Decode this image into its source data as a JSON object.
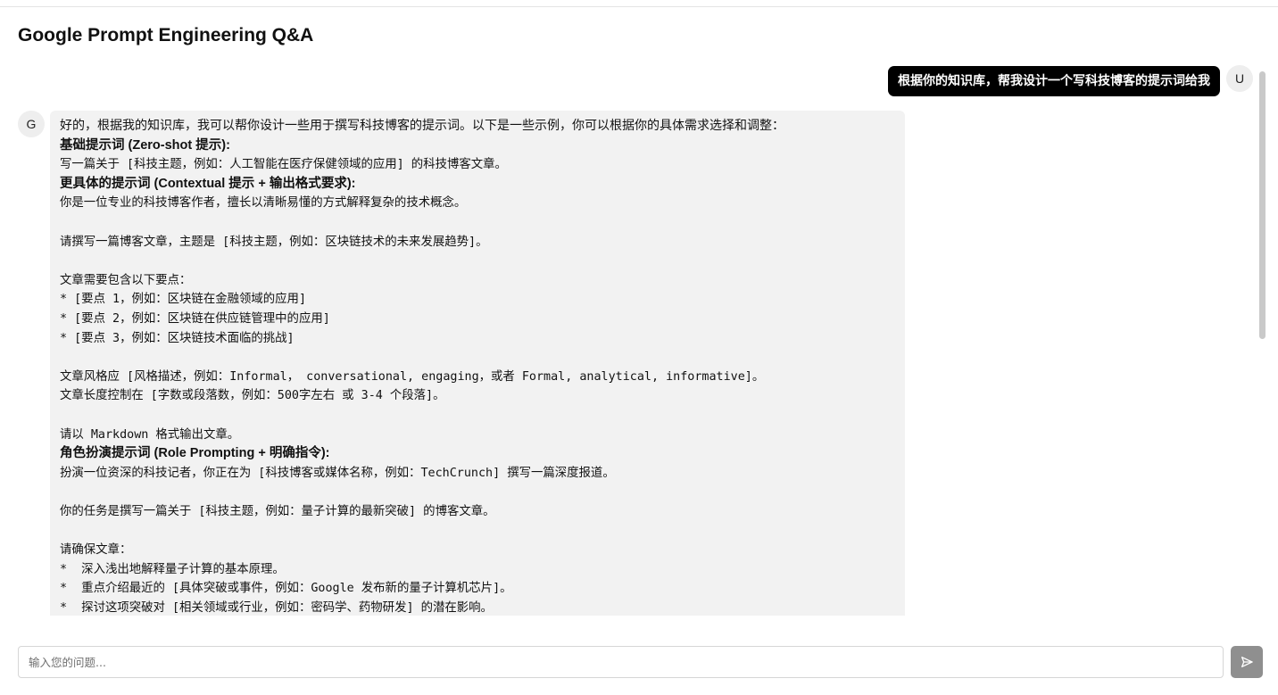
{
  "header": {
    "title": "Google Prompt Engineering Q&A"
  },
  "user_message": {
    "avatar_label": "U",
    "text": "根据你的知识库，帮我设计一个写科技博客的提示词给我"
  },
  "assistant_message": {
    "avatar_label": "G",
    "lines": [
      {
        "style": "normal",
        "text": "好的，根据我的知识库，我可以帮你设计一些用于撰写科技博客的提示词。以下是一些示例，你可以根据你的具体需求选择和调整："
      },
      {
        "style": "heading",
        "text": "基础提示词 (Zero-shot 提示):"
      },
      {
        "style": "mono",
        "text": "写一篇关于 [科技主题，例如：人工智能在医疗保健领域的应用] 的科技博客文章。"
      },
      {
        "style": "heading",
        "text": "更具体的提示词 (Contextual 提示 + 输出格式要求):"
      },
      {
        "style": "mono",
        "text": "你是一位专业的科技博客作者，擅长以清晰易懂的方式解释复杂的技术概念。"
      },
      {
        "style": "blank",
        "text": ""
      },
      {
        "style": "mono",
        "text": "请撰写一篇博客文章，主题是 [科技主题，例如：区块链技术的未来发展趋势]。"
      },
      {
        "style": "blank",
        "text": ""
      },
      {
        "style": "mono",
        "text": "文章需要包含以下要点："
      },
      {
        "style": "mono",
        "text": "* [要点 1，例如：区块链在金融领域的应用]"
      },
      {
        "style": "mono",
        "text": "* [要点 2，例如：区块链在供应链管理中的应用]"
      },
      {
        "style": "mono",
        "text": "* [要点 3，例如：区块链技术面临的挑战]"
      },
      {
        "style": "blank",
        "text": ""
      },
      {
        "style": "mono",
        "text": "文章风格应 [风格描述，例如：Informal， conversational, engaging，或者 Formal, analytical, informative]。"
      },
      {
        "style": "mono",
        "text": "文章长度控制在 [字数或段落数，例如：500字左右 或 3-4 个段落]。"
      },
      {
        "style": "blank",
        "text": ""
      },
      {
        "style": "mono",
        "text": "请以 Markdown 格式输出文章。"
      },
      {
        "style": "heading",
        "text": "角色扮演提示词 (Role Prompting + 明确指令):"
      },
      {
        "style": "mono",
        "text": "扮演一位资深的科技记者，你正在为 [科技博客或媒体名称，例如：TechCrunch] 撰写一篇深度报道。"
      },
      {
        "style": "blank",
        "text": ""
      },
      {
        "style": "mono",
        "text": "你的任务是撰写一篇关于 [科技主题，例如：量子计算的最新突破] 的博客文章。"
      },
      {
        "style": "blank",
        "text": ""
      },
      {
        "style": "mono",
        "text": "请确保文章："
      },
      {
        "style": "mono",
        "text": "*  深入浅出地解释量子计算的基本原理。"
      },
      {
        "style": "mono",
        "text": "*  重点介绍最近的 [具体突破或事件，例如：Google 发布新的量子计算机芯片]。"
      },
      {
        "style": "mono",
        "text": "*  探讨这项突破对 [相关领域或行业，例如：密码学、药物研发] 的潜在影响。"
      }
    ]
  },
  "composer": {
    "placeholder": "输入您的问题...",
    "send_icon": "send-icon"
  },
  "colors": {
    "user_bubble": "#000000",
    "assistant_bubble": "#f2f2f2",
    "send_button": "#8f8f8f"
  }
}
